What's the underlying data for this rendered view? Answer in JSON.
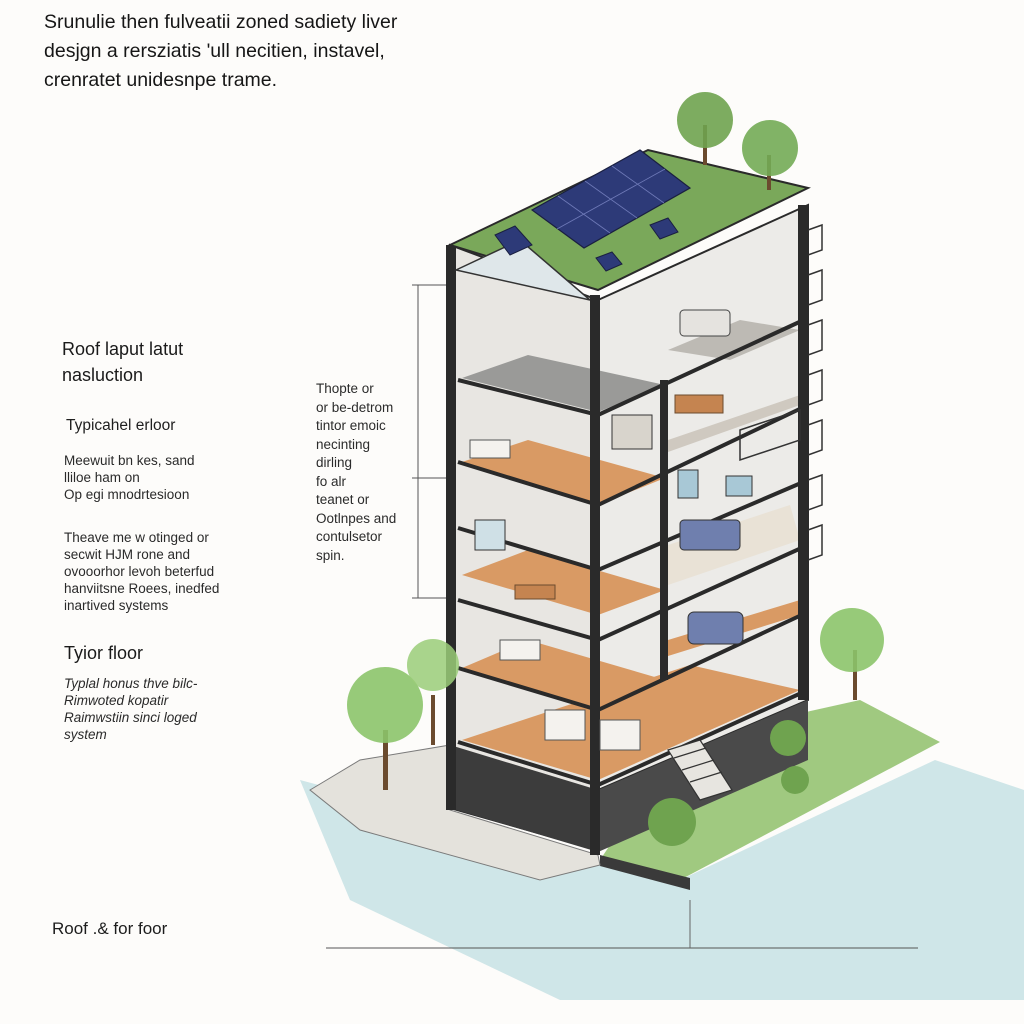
{
  "heading": {
    "lines": [
      "Srunulie then fulveatii zoned sadiety liver",
      "desjgn a rersziatis 'ull necitien, instavel,",
      "crenratet unidesnpe trame."
    ]
  },
  "left_labels": {
    "roof_title": [
      "Roof laput latut",
      "nasluction"
    ],
    "typical_floor_title": "Typicahel erloor",
    "note_one": [
      "Meewuit bn kes, sand",
      "lliloe ham on",
      "Op egi mnodrtesioon"
    ],
    "note_two": [
      "Theave me w otinged or",
      "   secwit HJM rone and",
      "ovooorhor levoh beterfud",
      "hanviitsne Roees, inedfed",
      "inartived systems"
    ],
    "tyior_floor_title": "Tyior floor",
    "note_three": [
      "Typlal honus thve bilc-",
      "Rimwoted kopatir",
      "Raimwstiin sinci loged",
      "system"
    ]
  },
  "middle_notes": {
    "lines": [
      "Thopte or",
      "or be-detrom",
      "tintor emoic",
      "necinting",
      "dirling",
      "fo alr",
      "teanet or",
      "Ootlnpes and",
      "contulsetor",
      "spin."
    ]
  },
  "footer_label": "Roof .& for foor",
  "colors": {
    "ink": "#1c1c1c",
    "wood_floor": "#d99a64",
    "concrete_slab": "#3a3a3a",
    "green_roof": "#7aa85a",
    "solar_panel": "#2d3a78",
    "grass": "#8fbf6a",
    "water": "#a9d3d8",
    "interior_wall": "#c9c6c0",
    "bedding": "#6f7fae"
  },
  "icons": [
    "tree-icon",
    "solar-panel-icon",
    "stair-icon"
  ]
}
